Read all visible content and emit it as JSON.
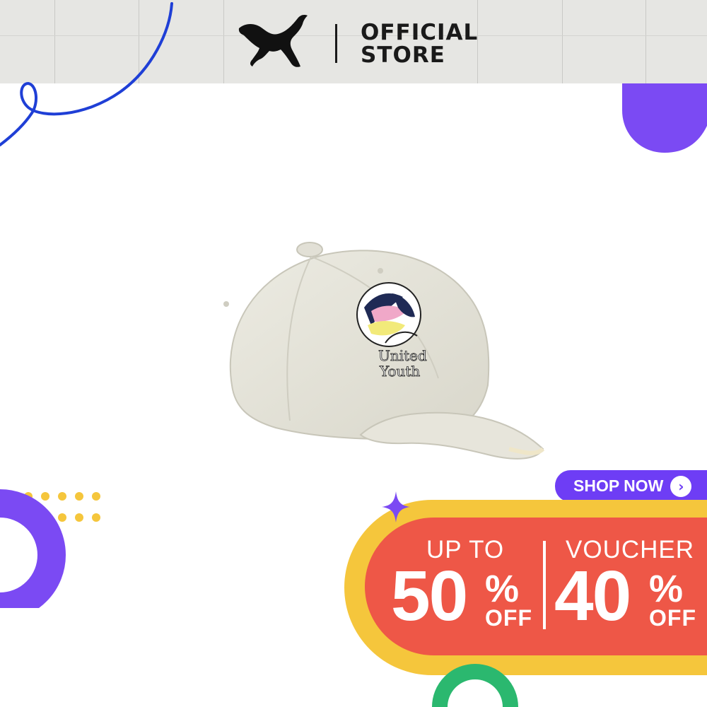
{
  "header": {
    "brand_icon": "puma-cat-logo",
    "store_line1": "OFFICIAL",
    "store_line2": "STORE"
  },
  "product": {
    "image": "beige-baseball-cap",
    "embroidery_line1": "United",
    "embroidery_line2": "Youth"
  },
  "cta": {
    "label": "SHOP NOW",
    "icon": "chevron-right-icon"
  },
  "promo": {
    "left_top": "UP TO",
    "left_value": "50",
    "left_percent": "%",
    "left_off": "OFF",
    "right_top": "VOUCHER",
    "right_value": "40",
    "right_percent": "%",
    "right_off": "OFF"
  },
  "colors": {
    "header_bg": "#e6e6e3",
    "purple": "#6e3df5",
    "yellow": "#f5c63c",
    "red": "#ee5747",
    "green": "#2bb86f",
    "blue_line": "#1f3fd6"
  }
}
